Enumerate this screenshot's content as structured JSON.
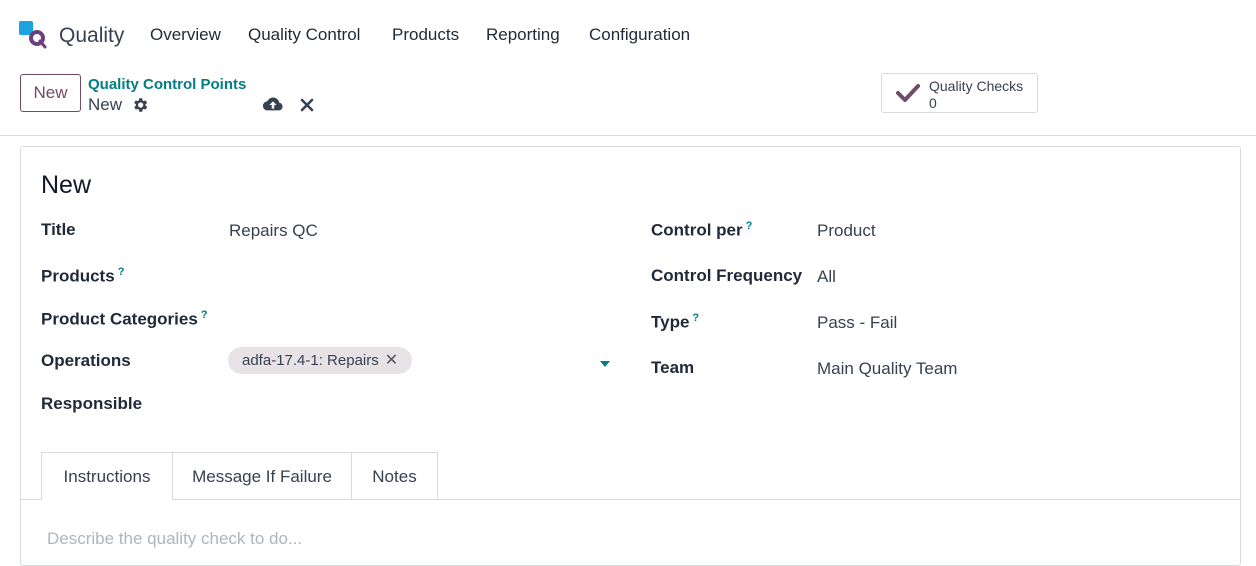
{
  "app": {
    "name": "Quality",
    "logo_icon": "quality-app-logo"
  },
  "menu": [
    {
      "label": "Overview"
    },
    {
      "label": "Quality Control"
    },
    {
      "label": "Products"
    },
    {
      "label": "Reporting"
    },
    {
      "label": "Configuration"
    }
  ],
  "control_bar": {
    "new_label": "New",
    "breadcrumb_parent": "Quality Control Points",
    "breadcrumb_current": "New"
  },
  "smart_button": {
    "label": "Quality Checks",
    "count": "0"
  },
  "record": {
    "title": "New"
  },
  "fields_left": [
    {
      "label": "Title",
      "help": "",
      "value": "Repairs QC"
    },
    {
      "label": "Products",
      "help": "?",
      "value": ""
    },
    {
      "label": "Product Categories",
      "help": "?",
      "value": ""
    },
    {
      "label": "Operations",
      "help": "",
      "value": ""
    },
    {
      "label": "Responsible",
      "help": "",
      "value": ""
    }
  ],
  "operations_tag": "adfa-17.4-1: Repairs",
  "fields_right": [
    {
      "label": "Control per",
      "help": "?",
      "value": "Product"
    },
    {
      "label": "Control Frequency",
      "help": "",
      "value": "All"
    },
    {
      "label": "Type",
      "help": "?",
      "value": "Pass - Fail"
    },
    {
      "label": "Team",
      "help": "",
      "value": "Main Quality Team"
    }
  ],
  "tabs": [
    {
      "label": "Instructions",
      "active": true
    },
    {
      "label": "Message If Failure",
      "active": false
    },
    {
      "label": "Notes",
      "active": false
    }
  ],
  "instructions_placeholder": "Describe the quality check to do...",
  "colors": {
    "brand": "#714b67",
    "link": "#017e84",
    "border": "#d8dadd"
  }
}
